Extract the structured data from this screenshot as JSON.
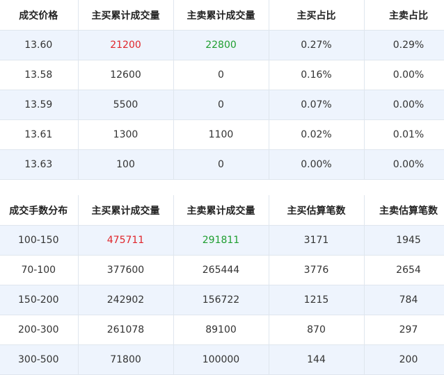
{
  "price_table": {
    "headers": [
      "成交价格",
      "主买累计成交量",
      "主卖累计成交量",
      "主买占比",
      "主卖占比"
    ],
    "rows": [
      [
        "13.60",
        "21200",
        "22800",
        "0.27%",
        "0.29%"
      ],
      [
        "13.58",
        "12600",
        "0",
        "0.16%",
        "0.00%"
      ],
      [
        "13.59",
        "5500",
        "0",
        "0.07%",
        "0.00%"
      ],
      [
        "13.61",
        "1300",
        "1100",
        "0.02%",
        "0.01%"
      ],
      [
        "13.63",
        "100",
        "0",
        "0.00%",
        "0.00%"
      ]
    ]
  },
  "size_table": {
    "headers": [
      "成交手数分布",
      "主买累计成交量",
      "主卖累计成交量",
      "主买估算笔数",
      "主卖估算笔数"
    ],
    "rows": [
      [
        "100-150",
        "475711",
        "291811",
        "3171",
        "1945"
      ],
      [
        "70-100",
        "377600",
        "265444",
        "3776",
        "2654"
      ],
      [
        "150-200",
        "242902",
        "156722",
        "1215",
        "784"
      ],
      [
        "200-300",
        "261078",
        "89100",
        "870",
        "297"
      ],
      [
        "300-500",
        "71800",
        "100000",
        "144",
        "200"
      ]
    ]
  },
  "colors": {
    "buy_highlight": "#e0252b",
    "sell_highlight": "#1e9e30",
    "alt_row": "#eef4fd"
  }
}
